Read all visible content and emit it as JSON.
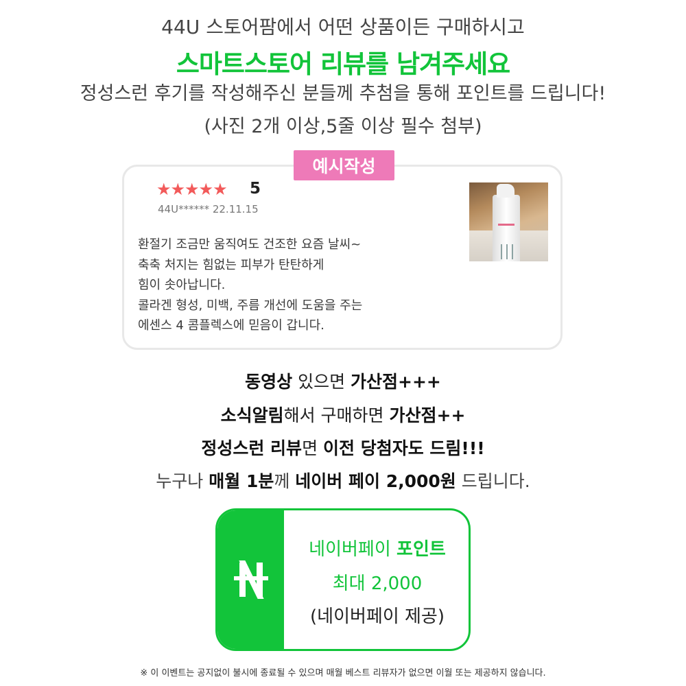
{
  "header": {
    "line1": "44U 스토어팜에서 어떤 상품이든 구매하시고",
    "line2": "스마트스토어 리뷰를 남겨주세요",
    "line3": "정성스런 후기를 작성해주신 분들께 추첨을 통해 포인트를 드립니다!",
    "line4": "(사진 2개 이상,5줄 이상 필수 첨부)",
    "accent_color": "#12c43a"
  },
  "example": {
    "badge": "예시작성",
    "badge_color": "#ee7ab8",
    "stars": "★★★★★",
    "rating": "5",
    "reviewer": "44U****** 22.11.15",
    "review_lines": [
      "환절기 조금만 움직여도  건조한 요즘 날씨~",
      "축축 처지는 힘없는 피부가 탄탄하게",
      "힘이 솟아납니다.",
      "콜라겐 형성, 미백, 주름 개선에  도움을 주는",
      "에센스 4 콤플렉스에 믿음이 갑니다."
    ],
    "photo_icon": "product-bottle-photo"
  },
  "benefits": {
    "b1": {
      "strong": "동영상",
      "plain": " 있으면 ",
      "strong2": "가산점+++"
    },
    "b2": {
      "strong": "소식알림",
      "plain": "해서 구매하면 ",
      "strong2": "가산점++"
    },
    "b3": {
      "strong": "정성스런 리뷰",
      "plain": "면 ",
      "strong2": "이전 당첨자도 드림!!!"
    },
    "b4": {
      "plain1": "누구나 ",
      "strong": "매월 1분",
      "plain2": "께 ",
      "strong2": "네이버 페이 2,000원",
      "plain3": " 드립니다."
    }
  },
  "naverpay": {
    "logo_icon": "naver-n-icon",
    "title_plain": "네이버페이 ",
    "title_bold": "포인트",
    "amount": "최대 2,000",
    "provider": "(네이버페이 제공)"
  },
  "footer": {
    "notice": "※ 이 이벤트는 공지없이 불시에 종료될 수 있으며 매월 베스트 리뷰자가 없으면 이월 또는 제공하지 않습니다."
  }
}
